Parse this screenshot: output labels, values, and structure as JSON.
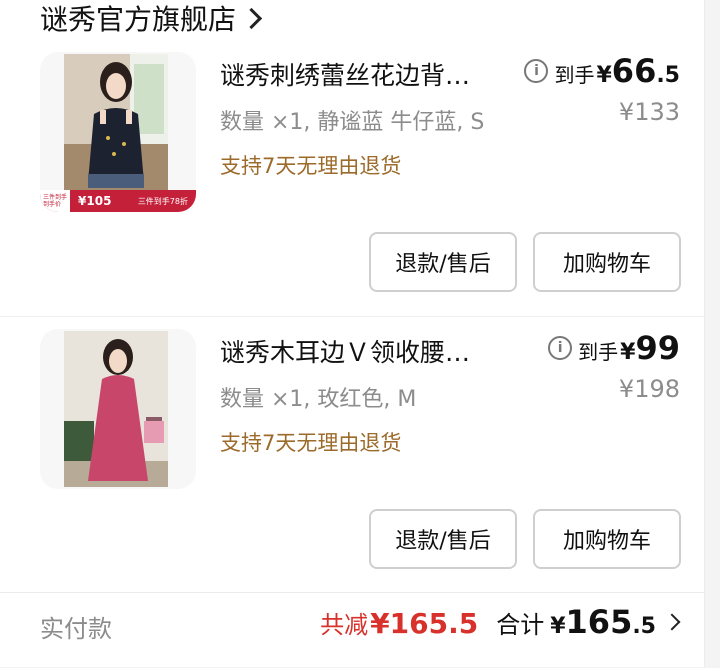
{
  "store": {
    "name": "谜秀官方旗舰店"
  },
  "items": [
    {
      "title": "谜秀刺绣蕾丝花边背…",
      "spec": "数量 ×1, 静谧蓝 牛仔蓝, S",
      "policy": "支持7天无理由退货",
      "price_label": "到手",
      "price_currency": "¥",
      "price_main": "66",
      "price_decimal": ".5",
      "original_price": "¥133",
      "refund_label": "退款/售后",
      "cart_label": "加购物车",
      "banner": {
        "left_line1": "三件到手",
        "left_line2": "到手价",
        "price": "¥105",
        "right": "三件到手78折"
      }
    },
    {
      "title": "谜秀木耳边Ｖ领收腰…",
      "spec": "数量 ×1, 玫红色, M",
      "policy": "支持7天无理由退货",
      "price_label": "到手",
      "price_currency": "¥",
      "price_main": "99",
      "price_decimal": "",
      "original_price": "¥198",
      "refund_label": "退款/售后",
      "cart_label": "加购物车"
    }
  ],
  "footer": {
    "label": "实付款",
    "discount_label": "共减",
    "discount_value": "¥165.5",
    "total_label": "合计",
    "total_currency": "¥",
    "total_main": "165",
    "total_decimal": ".5"
  },
  "colors": {
    "discount_red": "#d8312b",
    "policy_brown": "#9c6a2a",
    "banner_red": "#c4203a"
  }
}
